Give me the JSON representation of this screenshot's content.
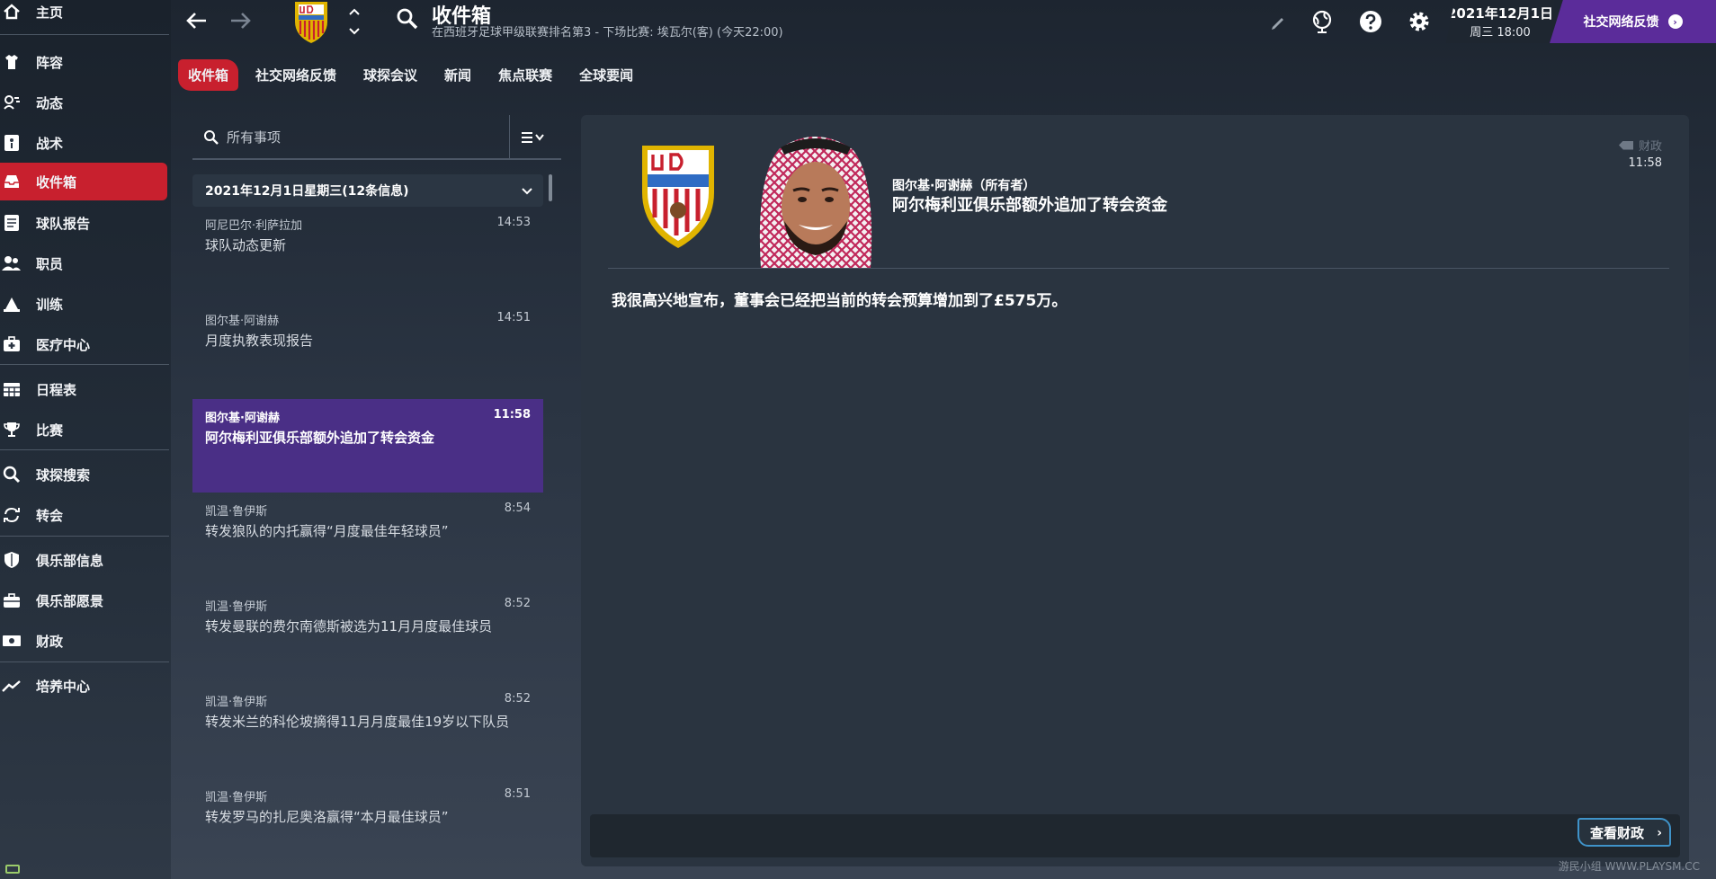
{
  "sidebar": {
    "items": [
      {
        "label": "主页",
        "icon": "home-icon"
      },
      {
        "label": "阵容",
        "icon": "shirt-icon"
      },
      {
        "label": "动态",
        "icon": "dynamics-icon"
      },
      {
        "label": "战术",
        "icon": "tactics-icon"
      },
      {
        "label": "收件箱",
        "icon": "inbox-icon",
        "active": true
      },
      {
        "label": "球队报告",
        "icon": "report-icon"
      },
      {
        "label": "职员",
        "icon": "staff-icon"
      },
      {
        "label": "训练",
        "icon": "training-icon"
      },
      {
        "label": "医疗中心",
        "icon": "medical-icon"
      },
      {
        "label": "日程表",
        "icon": "calendar-icon"
      },
      {
        "label": "比赛",
        "icon": "trophy-icon"
      },
      {
        "label": "球探搜索",
        "icon": "search-icon"
      },
      {
        "label": "转会",
        "icon": "transfer-icon"
      },
      {
        "label": "俱乐部信息",
        "icon": "shield-icon"
      },
      {
        "label": "俱乐部愿景",
        "icon": "vision-icon"
      },
      {
        "label": "财政",
        "icon": "finance-icon"
      },
      {
        "label": "培养中心",
        "icon": "development-icon"
      }
    ]
  },
  "header": {
    "title": "收件箱",
    "subtitle": "在西班牙足球甲级联赛排名第3 - 下场比赛: 埃瓦尔(客) (今天22:00)",
    "date": "2021年12月1日",
    "weekday_time": "周三 18:00",
    "social_button": "社交网络反馈"
  },
  "tabs": [
    "收件箱",
    "社交网络反馈",
    "球探会议",
    "新闻",
    "焦点联赛",
    "全球要闻"
  ],
  "inbox": {
    "search_placeholder": "所有事项",
    "date_group": "2021年12月1日星期三(12条信息)",
    "messages": [
      {
        "sender": "阿尼巴尔·利萨拉加",
        "time": "14:53",
        "subject": "球队动态更新"
      },
      {
        "sender": "图尔基·阿谢赫",
        "time": "14:51",
        "subject": "月度执教表现报告"
      },
      {
        "sender": "图尔基·阿谢赫",
        "time": "11:58",
        "subject": "阿尔梅利亚俱乐部额外追加了转会资金",
        "active": true
      },
      {
        "sender": "凯温·鲁伊斯",
        "time": "8:54",
        "subject": "转发狼队的内托赢得“月度最佳年轻球员”"
      },
      {
        "sender": "凯温·鲁伊斯",
        "time": "8:52",
        "subject": "转发曼联的费尔南德斯被选为11月月度最佳球员"
      },
      {
        "sender": "凯温·鲁伊斯",
        "time": "8:52",
        "subject": "转发米兰的科伦坡摘得11月月度最佳19岁以下队员"
      },
      {
        "sender": "凯温·鲁伊斯",
        "time": "8:51",
        "subject": "转发罗马的扎尼奥洛赢得“本月最佳球员”"
      }
    ]
  },
  "detail": {
    "from": "图尔基·阿谢赫（所有者）",
    "subject": "阿尔梅利亚俱乐部额外追加了转会资金",
    "category": "财政",
    "time": "11:58",
    "body": "我很高兴地宣布，董事会已经把当前的转会预算增加到了£575万。",
    "action_button": "查看财政"
  },
  "watermark": "游民小组 WWW.PLAYSM.CC",
  "colors": {
    "accent_red": "#c8202e",
    "accent_purple": "#5b2c9a",
    "selected_message": "#4a2f86",
    "button_border": "#3f93c9"
  }
}
